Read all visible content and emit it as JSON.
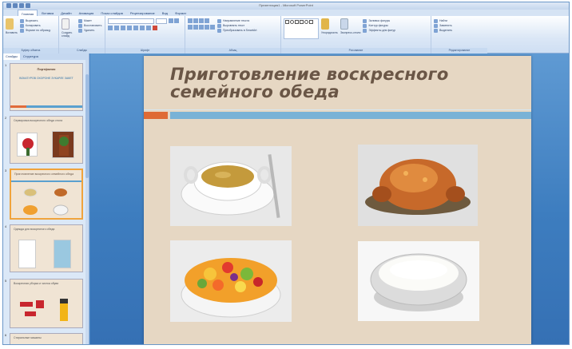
{
  "window": {
    "title": "Презентация1 - Microsoft PowerPoint"
  },
  "ribbon_tabs": [
    {
      "label": "Главная",
      "active": true
    },
    {
      "label": "Вставка",
      "active": false
    },
    {
      "label": "Дизайн",
      "active": false
    },
    {
      "label": "Анимация",
      "active": false
    },
    {
      "label": "Показ слайдов",
      "active": false
    },
    {
      "label": "Рецензирование",
      "active": false
    },
    {
      "label": "Вид",
      "active": false
    },
    {
      "label": "Формат",
      "active": false
    }
  ],
  "ribbon": {
    "clipboard": {
      "label": "Буфер обмена",
      "paste": "Вставить",
      "cut": "Вырезать",
      "copy": "Копировать",
      "format_painter": "Формат по образцу"
    },
    "slides": {
      "label": "Слайды",
      "new_slide": "Создать слайд",
      "layout": "Макет",
      "reset": "Восстановить",
      "delete": "Удалить"
    },
    "font": {
      "label": "Шрифт"
    },
    "paragraph": {
      "label": "Абзац",
      "text_direction": "Направление текста",
      "align_text": "Выровнять текст",
      "smartart": "Преобразовать в SmartArt"
    },
    "drawing": {
      "label": "Рисование",
      "arrange": "Упорядочить",
      "quick_styles": "Экспресс-стили",
      "shape_fill": "Заливка фигуры",
      "shape_outline": "Контур фигуры",
      "shape_effects": "Эффекты для фигур"
    },
    "editing": {
      "label": "Редактирование",
      "find": "Найти",
      "replace": "Заменить",
      "select": "Выделить"
    }
  },
  "pane": {
    "tab_slides": "Слайды",
    "tab_outline": "Структура",
    "thumbs": [
      {
        "num": "1",
        "title": "Портфолио",
        "sub": "ВОКАТУРОВ ОХОРОНЕ ЗУКАРЛЕ ЗАКЕТ"
      },
      {
        "num": "2",
        "caption": "Сервировка воскресного обеда стола"
      },
      {
        "num": "3",
        "caption": "Приготовление воскресного семейного обеда"
      },
      {
        "num": "4",
        "caption": "Одежда для воскресного обеда"
      },
      {
        "num": "5",
        "caption": "Воскресная уборка и чистка обуви"
      },
      {
        "num": "6",
        "caption": "Стиральные машины"
      }
    ]
  },
  "slide": {
    "title_line1": "Приготовление воскресного",
    "title_line2": "семейного обеда"
  },
  "colors": {
    "slide_bg": "#e6d7c3",
    "accent_orange": "#df6a34",
    "accent_blue": "#79b2d6",
    "title": "#6a5646"
  }
}
